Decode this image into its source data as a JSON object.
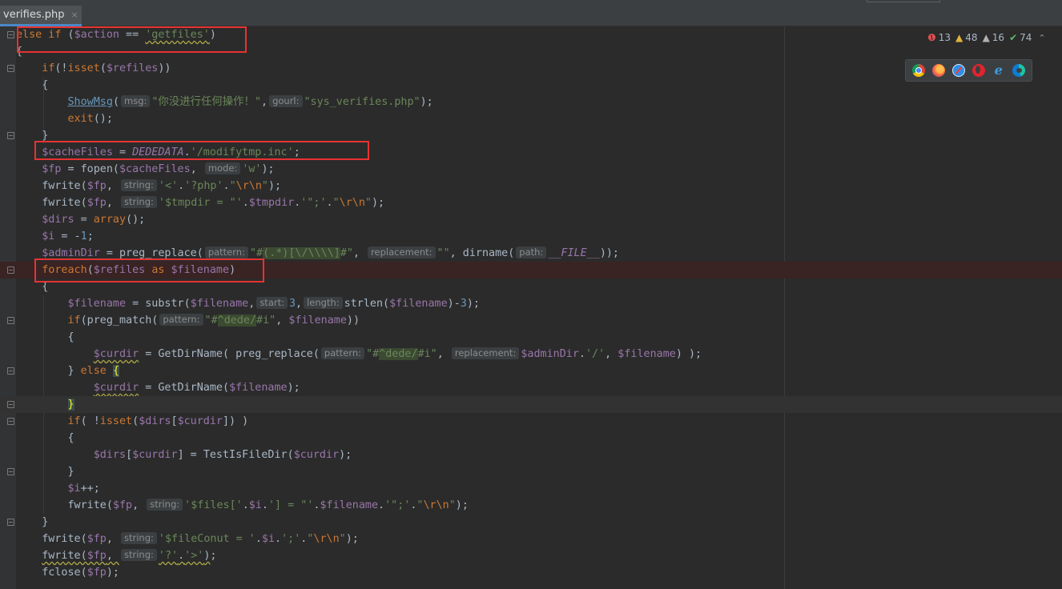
{
  "tab": {
    "file_name": "verifies.php",
    "close_glyph": "×"
  },
  "inspections": {
    "errors": "13",
    "warnings": "48",
    "weak_warnings": "16",
    "typos": "74",
    "error_icon": "error-icon",
    "warning_icon": "warning-icon",
    "weak_warning_icon": "weak-warning-icon",
    "ok_icon": "check-icon",
    "error_glyph": "❶",
    "warning_glyph": "▲",
    "weak_glyph": "▲",
    "typo_glyph": "✔",
    "collapse_glyph": "⌃"
  },
  "browsers": [
    {
      "name": "chrome-icon"
    },
    {
      "name": "firefox-icon"
    },
    {
      "name": "safari-icon"
    },
    {
      "name": "opera-icon"
    },
    {
      "name": "internet-explorer-icon",
      "glyph": "e"
    },
    {
      "name": "edge-icon"
    }
  ],
  "hints": {
    "msg": "msg:",
    "gourl": "gourl:",
    "mode": "mode:",
    "string": "string:",
    "pattern": "pattern:",
    "replacement": "replacement:",
    "path": "path:",
    "start": "start:",
    "length": "length:"
  },
  "code": {
    "l01_else": "else if",
    "l01_var": "$action",
    "l01_str": "'getfiles'",
    "l03_var": "$refiles",
    "l05_fn": "ShowMsg",
    "l05_s1": "\"你没进行任何操作！\"",
    "l05_s2": "\"sys_verifies.php\"",
    "l06_exit": "exit",
    "l08_var": "$cacheFiles",
    "l08_const": "DEDEDATA",
    "l08_str": "'/modifytmp.inc'",
    "l09_var": "$fp",
    "l09_var2": "$cacheFiles",
    "l09_str": "'w'",
    "l10_s1": "'<'",
    "l10_s2": "'?php'",
    "l10_s3": "\"",
    "l10_esc": "\\r\\n",
    "l11_s1": "'$tmpdir = \"'",
    "l11_var": "$tmpdir",
    "l11_s2": "'\";'",
    "l12_var": "$dirs",
    "l12_kw": "array",
    "l13_var": "$i",
    "l13_num": "1",
    "l14_var": "$adminDir",
    "l14_const": "__FILE__",
    "l15_var1": "$refiles",
    "l15_var2": "$filename",
    "l17_var": "$filename",
    "l17_num1": "3",
    "l17_num2": "3",
    "l18_s": "\"#^dede/#i\"",
    "l20_var": "$curdir",
    "l20_s2": "'/'",
    "l24_var1": "$dirs",
    "l24_var2": "$curdir",
    "l26_var1": "$dirs",
    "l26_var2": "$curdir",
    "l26_fn": "TestIsFileDir",
    "l28_var": "$i",
    "l29_s1": "'$files['",
    "l29_s2": "'] = \"'",
    "l29_s3": "'\";'",
    "l31_s1": "'$fileConut = '",
    "l31_s2": "';'",
    "l32_s1": "'?'",
    "l32_s2": "'>'",
    "l33_fn": "fclose"
  }
}
